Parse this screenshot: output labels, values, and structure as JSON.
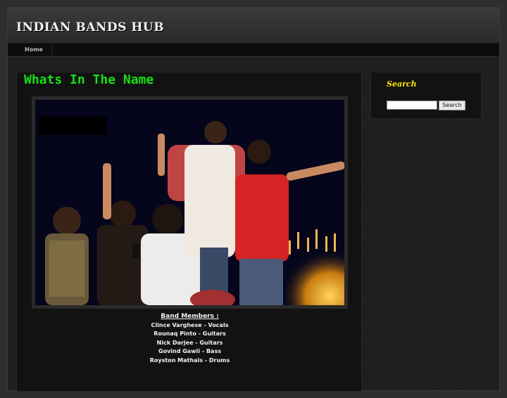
{
  "header": {
    "site_title": "INDIAN BANDS HUB"
  },
  "nav": {
    "home_label": "Home"
  },
  "post": {
    "title": "Whats In The Name",
    "band_members_heading": "Band Members :",
    "members": [
      "Clince Varghese - Vocals",
      "Rounaq Pinto - Guitars",
      "Nick Darjee - Guitars",
      "Govind Gawli - Bass",
      "Royston Mathais - Drums"
    ]
  },
  "sidebar": {
    "search_title": "Search",
    "search_button": "Search",
    "search_value": ""
  },
  "colors": {
    "post_title": "#16e016",
    "widget_title": "#ffe800",
    "photo_bg": "#05051c",
    "shirt_red": "#d42424"
  }
}
